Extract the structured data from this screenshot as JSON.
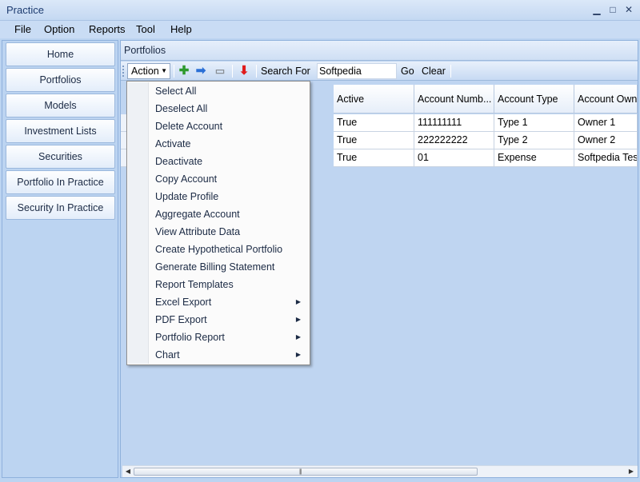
{
  "window": {
    "title": "Practice",
    "min_glyph": "▁",
    "max_glyph": "□",
    "close_glyph": "✕"
  },
  "menu": [
    "File",
    "Option",
    "Reports",
    "Tool",
    "Help"
  ],
  "nav": [
    "Home",
    "Portfolios",
    "Models",
    "Investment Lists",
    "Securities",
    "Portfolio In Practice",
    "Security In Practice"
  ],
  "panel": {
    "title": "Portfolios"
  },
  "toolbar": {
    "action_label": "Action",
    "action_arrow": "▼",
    "search_label": "Search For",
    "search_value": "Softpedia",
    "go_label": "Go",
    "clear_label": "Clear",
    "icons": {
      "add": "plus-icon",
      "export": "arrow-right-icon",
      "print": "printer-icon",
      "down": "arrow-down-icon"
    }
  },
  "grid": {
    "columns": [
      "Active",
      "Account Numb...",
      "Account Type",
      "Account Owne"
    ],
    "rows": [
      [
        "True",
        "111111111",
        "Type 1",
        "Owner 1"
      ],
      [
        "True",
        "222222222",
        "Type 2",
        "Owner 2"
      ],
      [
        "True",
        "01",
        "Expense",
        "Softpedia Test"
      ]
    ]
  },
  "scrollbar": {
    "left_arrow": "◀",
    "right_arrow": "▶",
    "grip": "|||"
  },
  "action_menu": [
    {
      "label": "Select All",
      "submenu": false
    },
    {
      "label": "Deselect All",
      "submenu": false
    },
    {
      "label": "Delete Account",
      "submenu": false
    },
    {
      "label": "Activate",
      "submenu": false
    },
    {
      "label": "Deactivate",
      "submenu": false
    },
    {
      "label": "Copy Account",
      "submenu": false
    },
    {
      "label": "Update Profile",
      "submenu": false
    },
    {
      "label": "Aggregate Account",
      "submenu": false
    },
    {
      "label": "View Attribute Data",
      "submenu": false
    },
    {
      "label": "Create Hypothetical Portfolio",
      "submenu": false
    },
    {
      "label": "Generate Billing Statement",
      "submenu": false
    },
    {
      "label": "Report Templates",
      "submenu": false
    },
    {
      "label": "Excel Export",
      "submenu": true
    },
    {
      "label": "PDF Export",
      "submenu": true
    },
    {
      "label": "Portfolio Report",
      "submenu": true
    },
    {
      "label": "Chart",
      "submenu": true
    }
  ],
  "submenu_arrow": "▶"
}
